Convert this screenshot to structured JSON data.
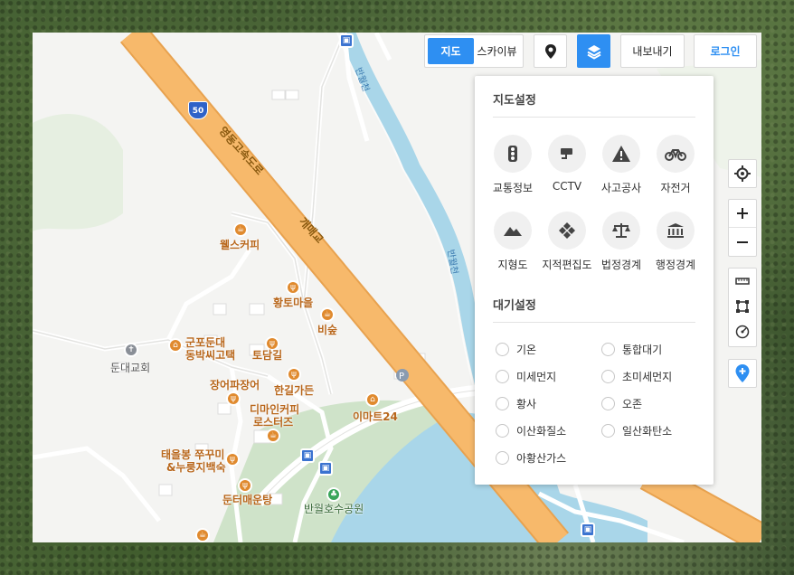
{
  "toolbar": {
    "map_tab": "지도",
    "skyview_tab": "스카이뷰",
    "streetview_icon": "streetview-pin-icon",
    "layers_icon": "layers-icon",
    "export_label": "내보내기",
    "login_label": "로그인"
  },
  "panel": {
    "map_settings_title": "지도설정",
    "map_items": [
      {
        "label": "교통정보",
        "icon": "traffic-light-icon"
      },
      {
        "label": "CCTV",
        "icon": "cctv-icon"
      },
      {
        "label": "사고공사",
        "icon": "warning-icon"
      },
      {
        "label": "자전거",
        "icon": "bicycle-icon"
      },
      {
        "label": "지형도",
        "icon": "terrain-icon"
      },
      {
        "label": "지적편집도",
        "icon": "cadastral-icon"
      },
      {
        "label": "법정경계",
        "icon": "scale-icon"
      },
      {
        "label": "행정경계",
        "icon": "government-icon"
      }
    ],
    "air_settings_title": "대기설정",
    "air_items": [
      {
        "label": "기온"
      },
      {
        "label": "통합대기"
      },
      {
        "label": "미세먼지"
      },
      {
        "label": "초미세먼지"
      },
      {
        "label": "황사"
      },
      {
        "label": "오존"
      },
      {
        "label": "이산화질소"
      },
      {
        "label": "일산화탄소"
      },
      {
        "label": "아황산가스"
      }
    ]
  },
  "map": {
    "highway_shield": "50",
    "highway_name": "영동고속도로",
    "bridge_name": "개매교",
    "stream_name_1": "반월천",
    "stream_name_2": "반월천",
    "pois": {
      "wells_coffee": "웰스커피",
      "hwangto": "황토마을",
      "bisum": "비숲",
      "gunpo_1": "군포둔대",
      "gunpo_2": "동박씨고택",
      "todamgil": "토담길",
      "church": "둔대교회",
      "janga": "장어파장어",
      "hangil": "한길가든",
      "dimain_1": "디마인커피",
      "dimain_2": "로스터즈",
      "emart": "이마트24",
      "taeeul_1": "태을봉 쭈꾸미",
      "taeeul_2": "&누룽지백숙",
      "dunteo": "둔터매운탕",
      "lake_park": "반월호수공원"
    }
  },
  "colors": {
    "accent": "#2e8ff2",
    "highway": "#f7b96b",
    "water": "#a9d6e9",
    "park": "#cfe3c9"
  }
}
